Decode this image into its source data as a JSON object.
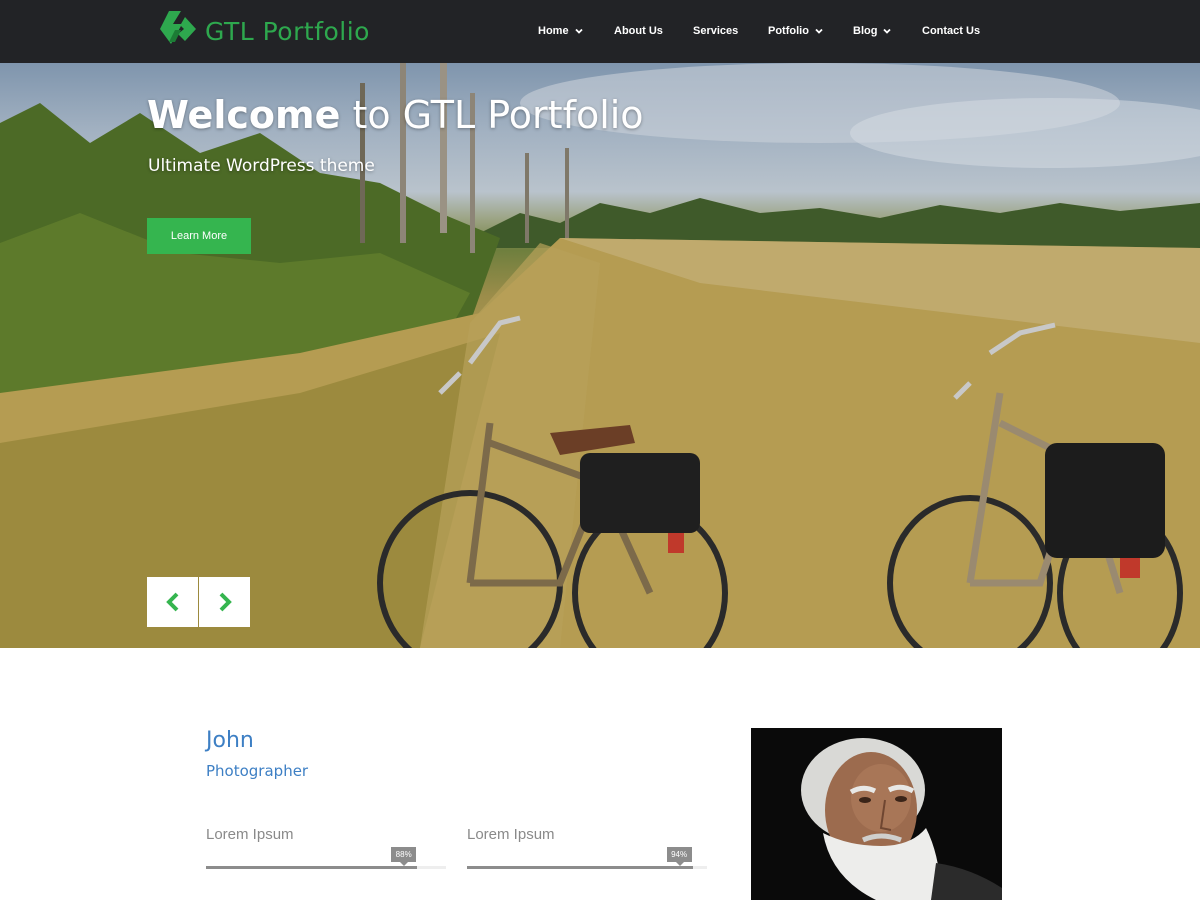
{
  "brand": {
    "name": "GTL Portfolio",
    "color": "#2ea84e",
    "icon": "gtl-logo-icon"
  },
  "nav": {
    "items": [
      {
        "label": "Home",
        "dropdown": true
      },
      {
        "label": "About Us",
        "dropdown": false
      },
      {
        "label": "Services",
        "dropdown": false
      },
      {
        "label": "Potfolio",
        "dropdown": true
      },
      {
        "label": "Blog",
        "dropdown": true
      },
      {
        "label": "Contact Us",
        "dropdown": false
      }
    ]
  },
  "hero": {
    "title_strong": "Welcome",
    "title_rest": "to GTL Portfolio",
    "subtitle": "Ultimate WordPress theme",
    "button_label": "Learn More",
    "button_color": "#35b54f",
    "prev_icon": "chevron-left-icon",
    "next_icon": "chevron-right-icon",
    "arrow_color": "#35b54f"
  },
  "profile": {
    "name": "John",
    "role": "Photographer",
    "accent": "#3d7fc4",
    "skills": [
      {
        "label": "Lorem Ipsum",
        "percent": 88,
        "percent_label": "88%"
      },
      {
        "label": "Lorem Ipsum",
        "percent": 94,
        "percent_label": "94%"
      }
    ]
  }
}
